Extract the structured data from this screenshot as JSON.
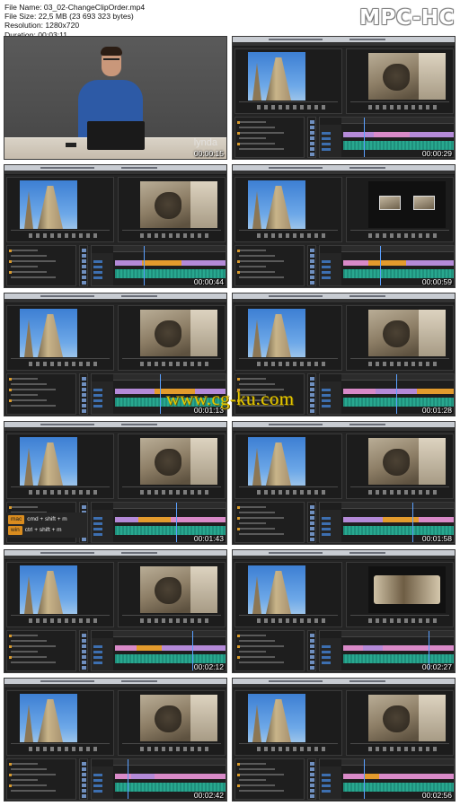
{
  "info": {
    "file_name": "File Name: 03_02-ChangeClipOrder.mp4",
    "file_size": "File Size: 22,5 MB (23 693 323 bytes)",
    "resolution": "Resolution: 1280x720",
    "duration": "Duration: 00:03:11"
  },
  "player_logo": "MPC-HC",
  "watermark": "www.cg-ku.com",
  "presenter_watermark": "lynda",
  "shortcut": {
    "mac": "mac",
    "mac_keys": "cmd + shift + m",
    "win": "win",
    "win_keys": "ctrl + shift + m"
  },
  "thumbnails": [
    {
      "time": "00:00:15",
      "kind": "presenter"
    },
    {
      "time": "00:00:29",
      "kind": "editor",
      "program": "photo"
    },
    {
      "time": "00:00:44",
      "kind": "editor",
      "program": "photo"
    },
    {
      "time": "00:00:59",
      "kind": "editor",
      "program": "pip"
    },
    {
      "time": "00:01:13",
      "kind": "editor",
      "program": "photo"
    },
    {
      "time": "00:01:28",
      "kind": "editor",
      "program": "photo"
    },
    {
      "time": "00:01:43",
      "kind": "editor",
      "program": "photo"
    },
    {
      "time": "00:01:58",
      "kind": "editor",
      "program": "photo"
    },
    {
      "time": "00:02:12",
      "kind": "editor",
      "program": "photo"
    },
    {
      "time": "00:02:27",
      "kind": "editor",
      "program": "wide"
    },
    {
      "time": "00:02:42",
      "kind": "editor",
      "program": "photo"
    },
    {
      "time": "00:02:56",
      "kind": "editor",
      "program": "photo"
    }
  ],
  "colors": {
    "clip_purple": "#b48ad8",
    "clip_orange": "#e39b2d",
    "clip_pink": "#d98ac8",
    "audio_teal": "#28a88f"
  }
}
